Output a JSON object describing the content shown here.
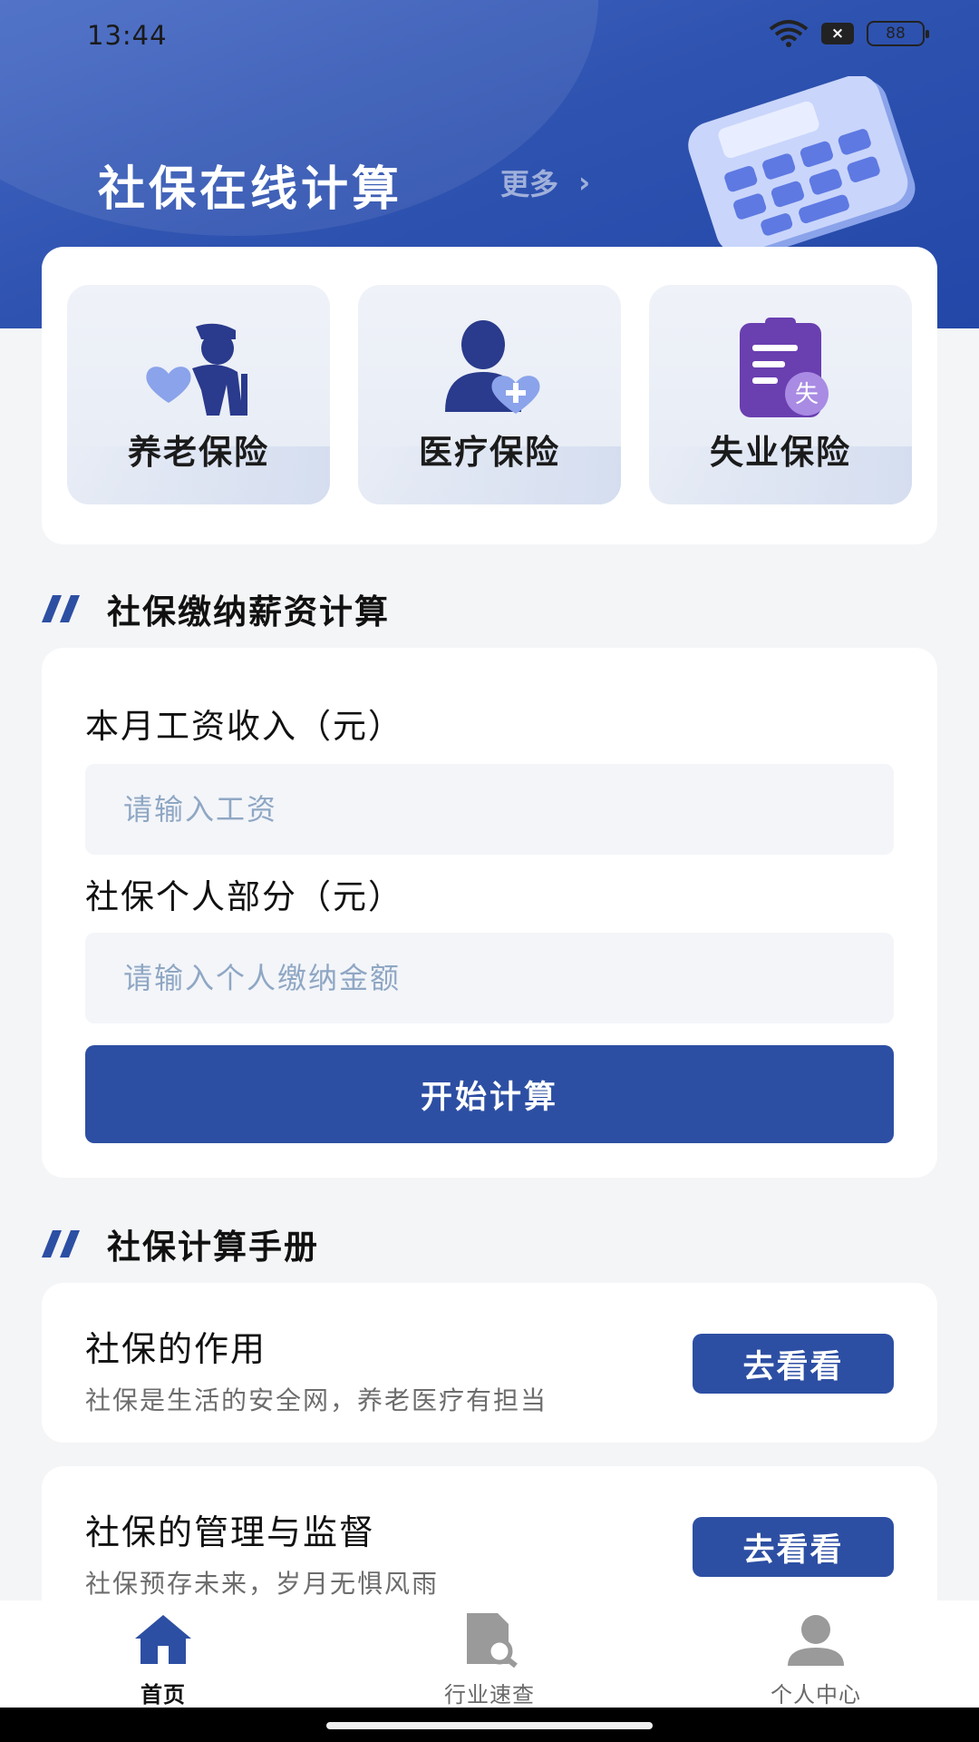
{
  "status_bar": {
    "time": "13:44",
    "battery": "88",
    "notif_badge": "×"
  },
  "header": {
    "title": "社保在线计算",
    "more_label": "更多",
    "more_chevron": "›"
  },
  "insurance": [
    {
      "label": "养老保险",
      "icon": "elderly-heart-icon"
    },
    {
      "label": "医疗保险",
      "icon": "person-medical-icon"
    },
    {
      "label": "失业保险",
      "icon": "clipboard-unemployment-icon",
      "icon_text": "失"
    }
  ],
  "salary_section": {
    "title": "社保缴纳薪资计算",
    "income_label": "本月工资收入（元）",
    "income_placeholder": "请输入工资",
    "personal_label": "社保个人部分（元）",
    "personal_placeholder": "请输入个人缴纳金额",
    "button_label": "开始计算"
  },
  "manual_section": {
    "title": "社保计算手册",
    "items": [
      {
        "title": "社保的作用",
        "subtitle": "社保是生活的安全网，养老医疗有担当",
        "button_label": "去看看"
      },
      {
        "title": "社保的管理与监督",
        "subtitle": "社保预存未来，岁月无惧风雨",
        "button_label": "去看看"
      }
    ]
  },
  "tabbar": [
    {
      "label": "首页",
      "icon": "home-icon",
      "active": true
    },
    {
      "label": "行业速查",
      "icon": "document-search-icon",
      "active": false
    },
    {
      "label": "个人中心",
      "icon": "user-icon",
      "active": false
    }
  ],
  "colors": {
    "primary": "#2d4fa3",
    "header": "#2f53b0",
    "icon_purple": "#6a3fb0",
    "icon_navy": "#2a3a8c"
  }
}
